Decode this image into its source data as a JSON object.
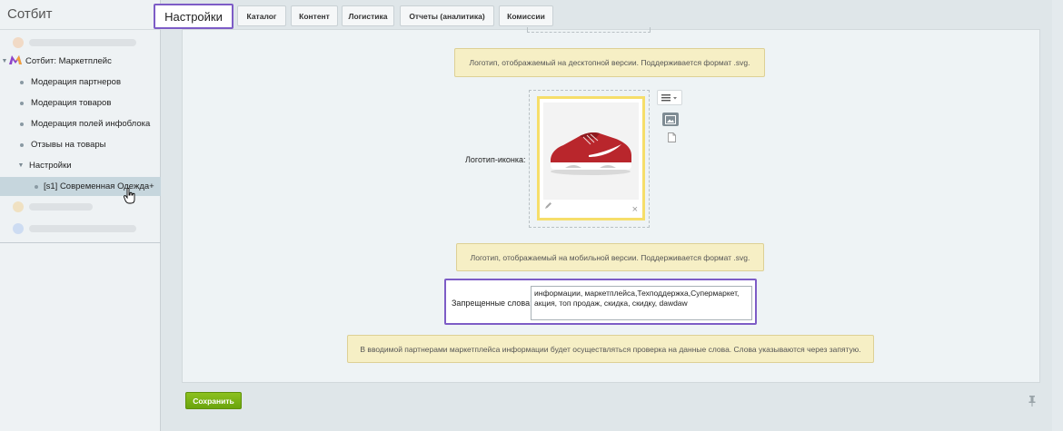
{
  "sidebar": {
    "title": "Сотбит",
    "items": [
      {
        "label": "Сотбит: Маркетплейс"
      },
      {
        "label": "Модерация партнеров"
      },
      {
        "label": "Модерация товаров"
      },
      {
        "label": "Модерация полей инфоблока"
      },
      {
        "label": "Отзывы на товары"
      },
      {
        "label": "Настройки"
      },
      {
        "label": "[s1] Современная Одежда+"
      }
    ]
  },
  "tabs": [
    {
      "label": "Настройки"
    },
    {
      "label": "Каталог"
    },
    {
      "label": "Контент"
    },
    {
      "label": "Логистика"
    },
    {
      "label": "Отчеты (аналитика)"
    },
    {
      "label": "Комиссии"
    }
  ],
  "form": {
    "desktop_logo_note": "Логотип, отображаемый на десктопной версии. Поддерживается формат .svg.",
    "icon_logo_label": "Логотип-иконка:",
    "mobile_logo_note": "Логотип, отображаемый на мобильной версии. Поддерживается формат .svg.",
    "forbidden_words_label": "Запрещенные слова:",
    "forbidden_words_value": "информации, маркетплейса,Техподдержка,Супермаркет, акция, топ продаж, скидка, скидку, dawdaw",
    "forbidden_words_note": "В вводимой партнерами маркетплейса информации будет осуществляться проверка на данные слова. Слова указываются через запятую."
  },
  "footer": {
    "save_label": "Сохранить"
  },
  "icons": {
    "marketplace_logo": "marketplace-logo-icon",
    "settings": "gear-icon",
    "pin": "pin-icon",
    "hand_cursor": "hand-cursor-icon"
  },
  "colors": {
    "accent": "#7d5cc6",
    "save_button": "#7ab317",
    "note_bg": "#f6efc5",
    "image_border": "#f6de6a"
  }
}
